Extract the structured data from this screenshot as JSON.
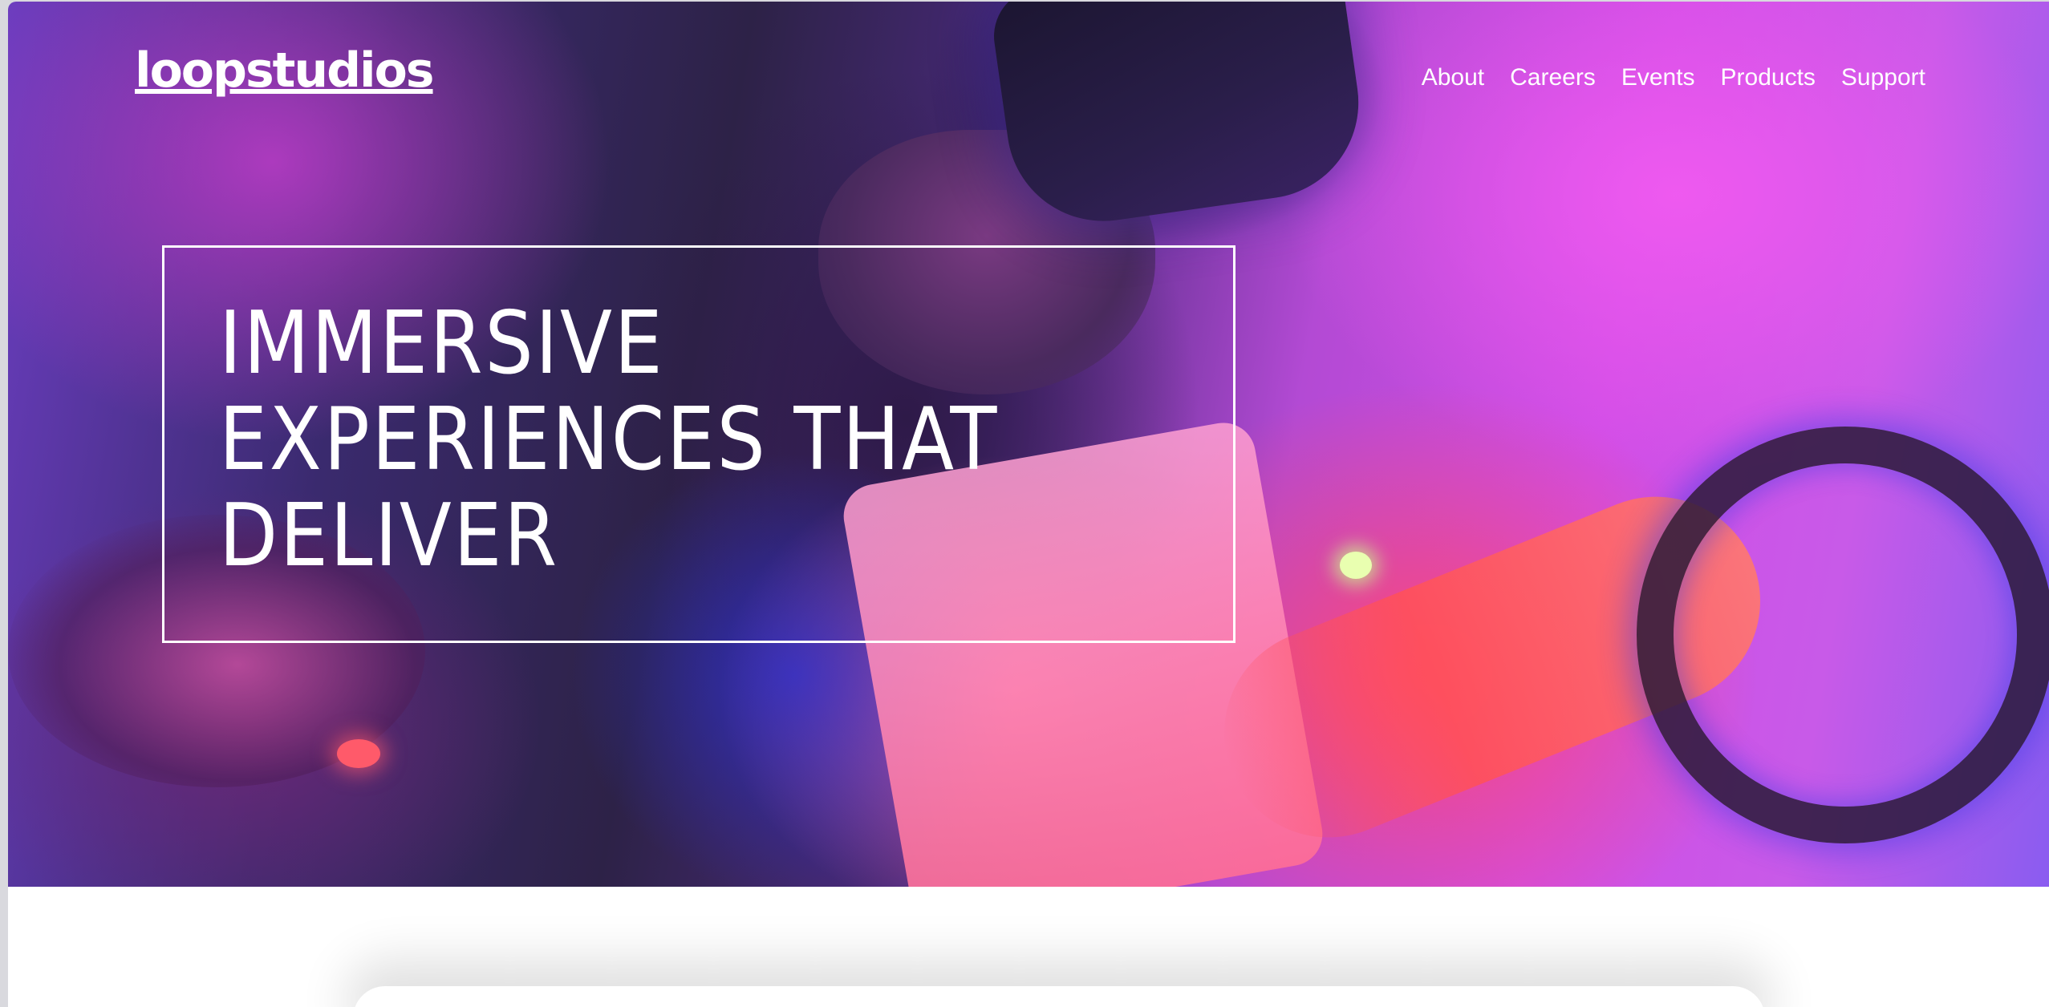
{
  "brand": {
    "logo_text": "loopstudios"
  },
  "nav": {
    "items": [
      {
        "label": "About"
      },
      {
        "label": "Careers"
      },
      {
        "label": "Events"
      },
      {
        "label": "Products"
      },
      {
        "label": "Support"
      }
    ]
  },
  "hero": {
    "headline": "Immersive experiences that deliver",
    "background_image_description_colors": {
      "magenta": "#d04de6",
      "violet": "#6a3dbf",
      "coral": "#ff5064",
      "blue": "#2832e6"
    }
  },
  "colors": {
    "text": "#ffffff",
    "page_background": "#ffffff"
  }
}
